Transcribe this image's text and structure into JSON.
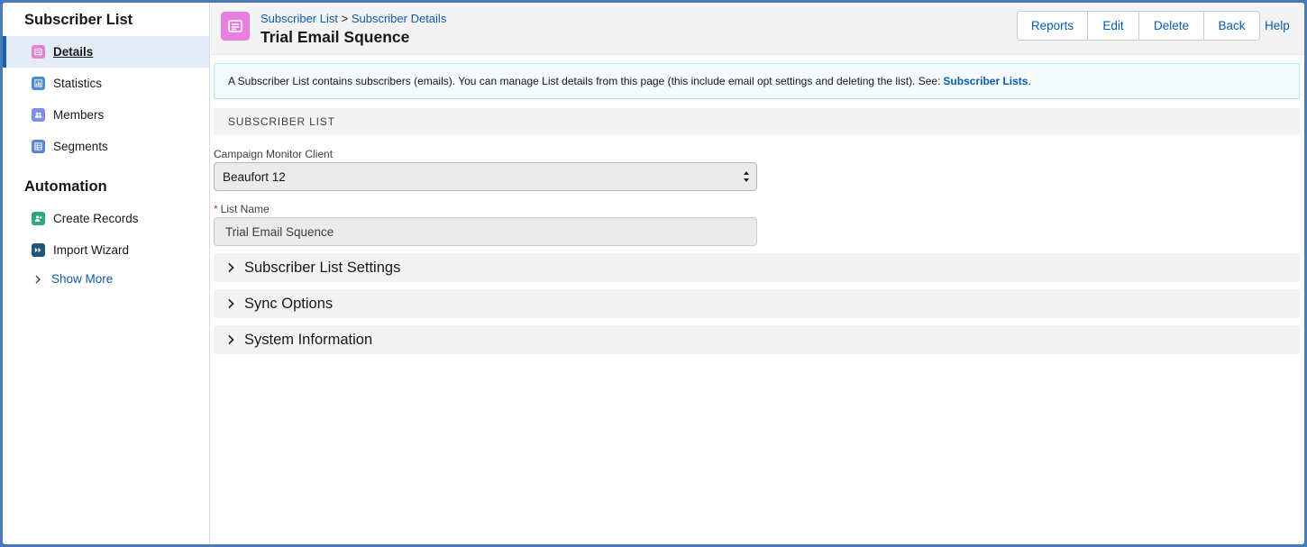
{
  "sidebar": {
    "section1_title": "Subscriber List",
    "items": [
      {
        "label": "Details",
        "icon": "details-icon",
        "color": "#e97fd5"
      },
      {
        "label": "Statistics",
        "icon": "chart-icon",
        "color": "#4c8bd6"
      },
      {
        "label": "Members",
        "icon": "people-icon",
        "color": "#7d90e8"
      },
      {
        "label": "Segments",
        "icon": "segments-icon",
        "color": "#5b86d4"
      }
    ],
    "section2_title": "Automation",
    "automation_items": [
      {
        "label": "Create Records",
        "icon": "create-records-icon",
        "color": "#2ea87b"
      },
      {
        "label": "Import Wizard",
        "icon": "import-wizard-icon",
        "color": "#1e5578"
      }
    ],
    "show_more": "Show More"
  },
  "header": {
    "breadcrumb_1": "Subscriber List",
    "breadcrumb_sep": ">",
    "breadcrumb_2": "Subscriber Details",
    "title": "Trial Email Squence",
    "buttons": {
      "reports": "Reports",
      "edit": "Edit",
      "delete": "Delete",
      "back": "Back"
    },
    "help": "Help",
    "icon_color": "#e77fe0"
  },
  "info": {
    "text": "A Subscriber List contains subscribers (emails). You can manage List details from this page (this include email opt settings and deleting the list). See:",
    "link": "Subscriber Lists",
    "period": "."
  },
  "section": {
    "title": "SUBSCRIBER LIST"
  },
  "fields": {
    "client_label": "Campaign Monitor Client",
    "client_value": "Beaufort 12",
    "list_name_required": "*",
    "list_name_label": "List Name",
    "list_name_value": "Trial Email Squence"
  },
  "accordions": [
    "Subscriber List Settings",
    "Sync Options",
    "System Information"
  ]
}
